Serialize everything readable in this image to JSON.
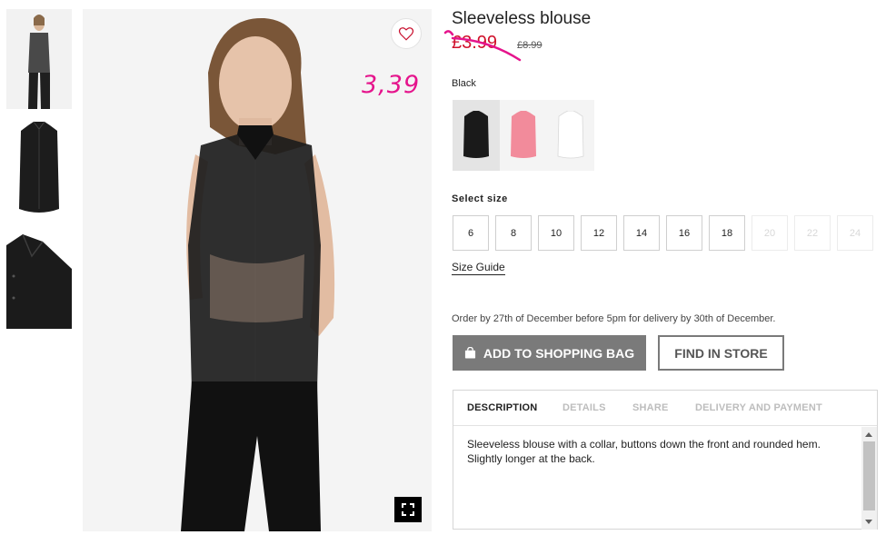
{
  "product": {
    "title": "Sleeveless blouse",
    "sale_price": "£3.99",
    "old_price": "£8.99",
    "annotation": "3,39",
    "color_label": "Black"
  },
  "swatches": [
    {
      "name": "black",
      "color": "#1a1a1a"
    },
    {
      "name": "pink",
      "color": "#f28b9b"
    },
    {
      "name": "white",
      "color": "#f7f5f0"
    }
  ],
  "size_section": {
    "label": "Select size",
    "sizes": [
      "6",
      "8",
      "10",
      "12",
      "14",
      "16",
      "18",
      "20",
      "22",
      "24"
    ],
    "guide_label": "Size Guide"
  },
  "delivery_note": "Order by 27th of December before 5pm for delivery by 30th of December.",
  "actions": {
    "add_to_bag": "ADD TO SHOPPING BAG",
    "find_in_store": "FIND IN STORE"
  },
  "info_tabs": {
    "description": "DESCRIPTION",
    "details": "DETAILS",
    "share": "SHARE",
    "delivery": "DELIVERY AND PAYMENT"
  },
  "description_text": "Sleeveless blouse with a collar, buttons down the front and rounded hem. Slightly longer at the back.",
  "icons": {
    "favorite": "heart-icon",
    "expand": "expand-icon",
    "bag": "shopping-bag-icon"
  },
  "colors": {
    "sale": "#d0112b",
    "annotation": "#e5148c",
    "button_primary": "#7a7a7a"
  }
}
